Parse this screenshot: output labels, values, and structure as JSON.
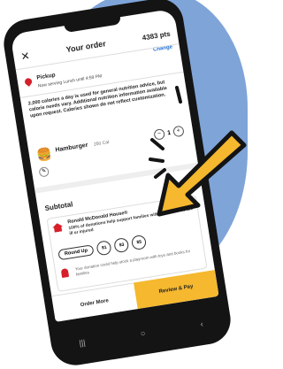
{
  "header": {
    "title": "Your order",
    "points": "4383 pts",
    "close": "✕",
    "change_label": "Change"
  },
  "pickup": {
    "label": "Pickup",
    "subtitle": "Now serving Lunch until 4:59 PM"
  },
  "calorie_note": "2,000 calories a day is used for general nutrition advice, but calorie needs vary. Additional nutrition information available upon request. Calories shown do not reflect customization.",
  "item": {
    "name": "Hamburger",
    "calories": "250 Cal",
    "quantity": "1",
    "minus": "−",
    "plus": "+",
    "edit": "✎"
  },
  "subtotal_label": "Subtotal",
  "rmhc": {
    "title": "Ronald McDonald House®",
    "description": "100% of donations help support families with children who are ill or injured",
    "round_up_label": "Round Up",
    "amounts": [
      "$1",
      "$3",
      "$5"
    ],
    "note": "Your donation could help stock a playroom with toys and books for families"
  },
  "bottom": {
    "order_more": "Order More",
    "review_pay": "Review & Pay"
  },
  "nav": [
    "|||",
    "○",
    "‹"
  ],
  "colors": {
    "accent_yellow": "#f5b82e",
    "brand_red": "#d61f2a",
    "link_blue": "#1b6bd6",
    "background_blue": "#7fa4d8"
  }
}
